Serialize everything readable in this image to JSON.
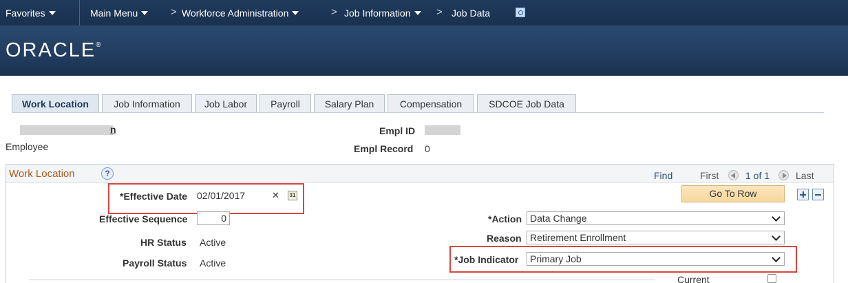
{
  "nav": {
    "favorites": "Favorites",
    "main_menu": "Main Menu",
    "breadcrumb": [
      "Workforce Administration",
      "Job Information",
      "Job Data"
    ],
    "separator": ">"
  },
  "brand": {
    "logo": "ORACLE",
    "mark": "®"
  },
  "tabs": [
    {
      "label": "Work Location",
      "active": true
    },
    {
      "label": "Job Information",
      "active": false
    },
    {
      "label": "Job Labor",
      "active": false
    },
    {
      "label": "Payroll",
      "active": false
    },
    {
      "label": "Salary Plan",
      "active": false
    },
    {
      "label": "Compensation",
      "active": false
    },
    {
      "label": "SDCOE Job Data",
      "active": false
    }
  ],
  "employee": {
    "name_suffix": "n",
    "type": "Employee",
    "empl_id_label": "Empl ID",
    "empl_record_label": "Empl Record",
    "empl_record_value": "0"
  },
  "section": {
    "title": "Work Location",
    "help": "?",
    "find": "Find",
    "first": "First",
    "page_count": "1 of 1",
    "last": "Last",
    "go_to_row": "Go To Row"
  },
  "form": {
    "effective_date_label": "*Effective Date",
    "effective_date_value": "02/01/2017",
    "clear_glyph": "✕",
    "calendar_glyph": "31",
    "effective_sequence_label": "Effective Sequence",
    "effective_sequence_value": "0",
    "hr_status_label": "HR Status",
    "hr_status_value": "Active",
    "payroll_status_label": "Payroll Status",
    "payroll_status_value": "Active",
    "action_label": "*Action",
    "action_value": "Data Change",
    "reason_label": "Reason",
    "reason_value": "Retirement Enrollment",
    "job_indicator_label": "*Job Indicator",
    "job_indicator_value": "Primary Job",
    "current_label": "Current"
  },
  "colors": {
    "nav_bg": "#1f3a5c",
    "highlight": "#d9453f",
    "section_title": "#a55a1a",
    "link": "#223a59"
  }
}
